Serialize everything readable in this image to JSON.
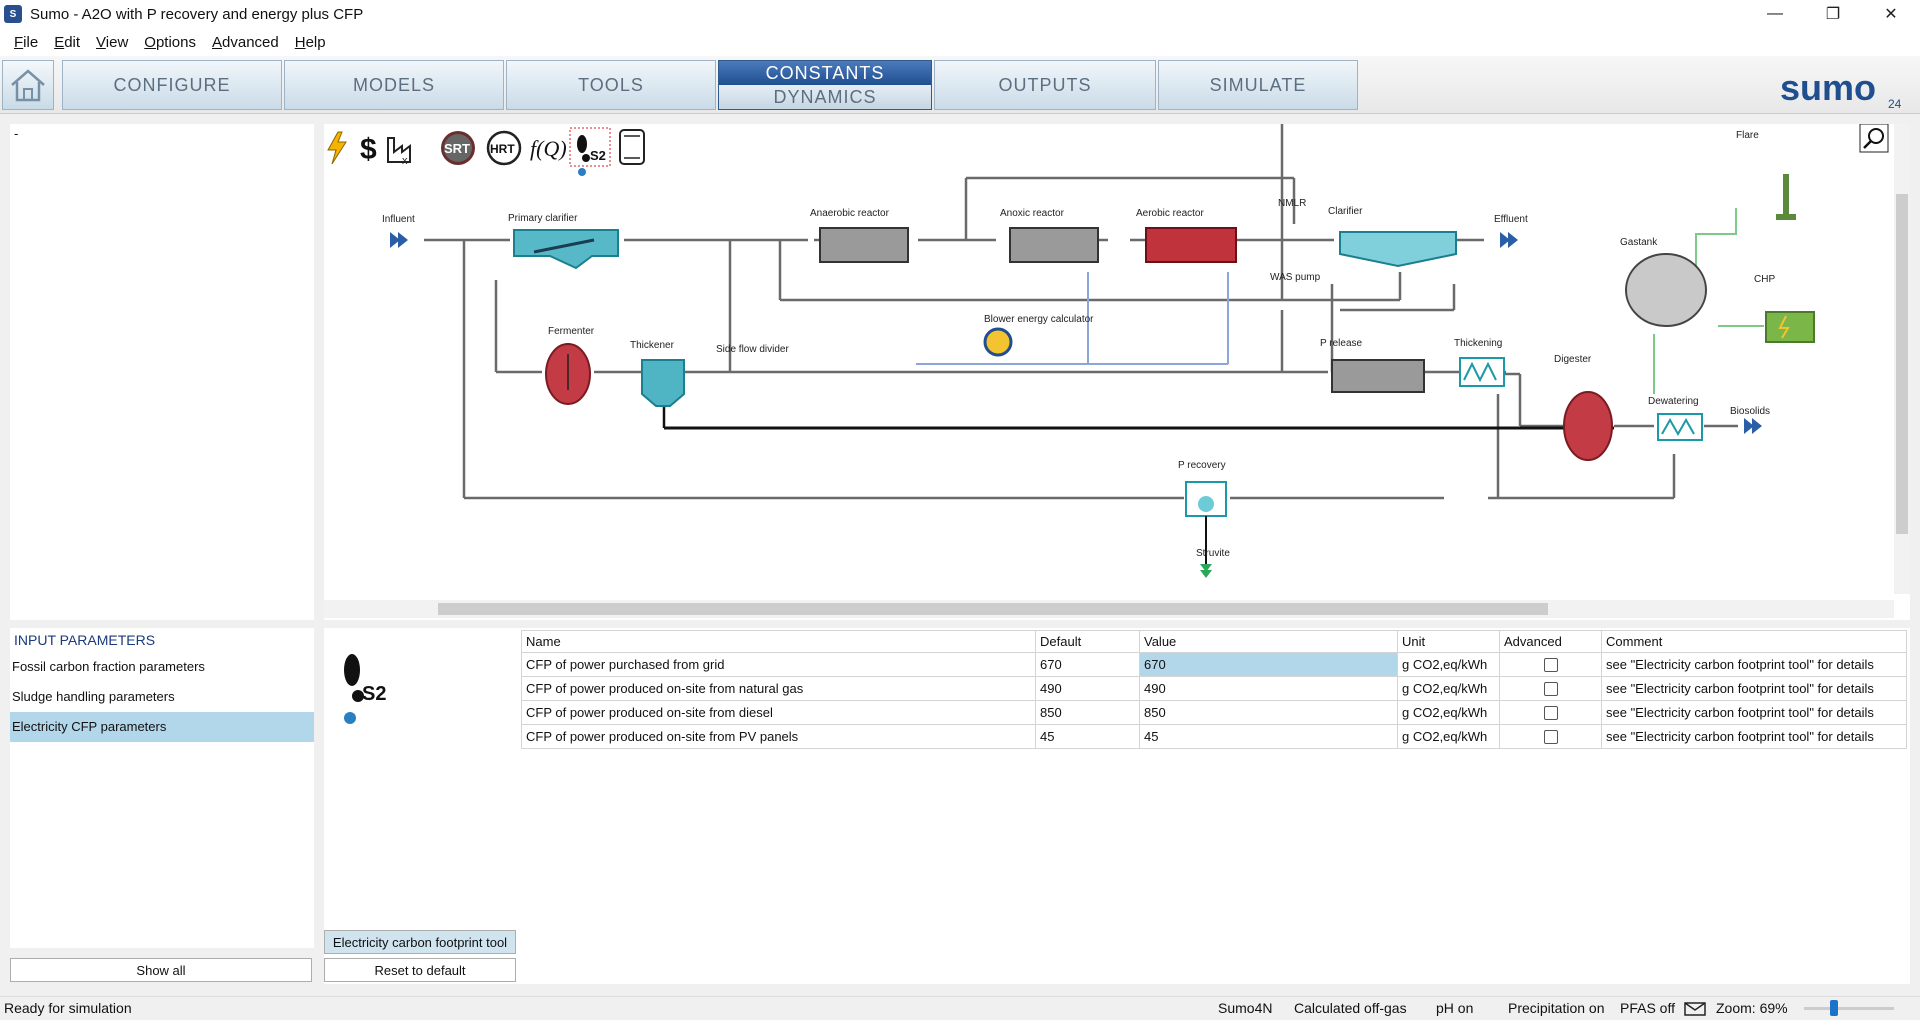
{
  "window": {
    "title": "Sumo - A2O with P recovery and energy plus CFP",
    "minimize": "—",
    "maximize": "❐",
    "close": "✕"
  },
  "menu": [
    {
      "label": "File",
      "key": "F"
    },
    {
      "label": "Edit",
      "key": "E"
    },
    {
      "label": "View",
      "key": "V"
    },
    {
      "label": "Options",
      "key": "O"
    },
    {
      "label": "Advanced",
      "key": "A"
    },
    {
      "label": "Help",
      "key": "H"
    }
  ],
  "tabs": {
    "configure": "CONFIGURE",
    "models": "MODELS",
    "tools": "TOOLS",
    "constants": "CONSTANTS",
    "dynamics": "DYNAMICS",
    "outputs": "OUTPUTS",
    "simulate": "SIMULATE"
  },
  "logo": {
    "text": "sumo",
    "sub": "24"
  },
  "left_top": {
    "text": "-"
  },
  "toolbar_icons": [
    "lightning-icon",
    "dollar-icon",
    "factory-icon",
    "srt-icon",
    "hrt-icon",
    "function-icon",
    "footprint-icon",
    "scroll-icon"
  ],
  "toolbar_labels": {
    "srt": "SRT",
    "hrt": "HRT",
    "fq": "f(Q)",
    "s2": "S2"
  },
  "diagram_labels": {
    "influent": "Influent",
    "primary_clarifier": "Primary clarifier",
    "fermenter": "Fermenter",
    "thickener": "Thickener",
    "side_flow_divider": "Side flow divider",
    "anaerobic_reactor": "Anaerobic reactor",
    "anoxic_reactor": "Anoxic reactor",
    "aerobic_reactor": "Aerobic reactor",
    "nmlr": "NMLR",
    "clarifier": "Clarifier",
    "effluent": "Effluent",
    "was_pump": "WAS pump",
    "blower": "Blower energy calculator",
    "p_release": "P release",
    "thickening": "Thickening",
    "digester": "Digester",
    "dewatering": "Dewatering",
    "biosolids": "Biosolids",
    "p_recovery": "P recovery",
    "struvite": "Struvite",
    "gastank": "Gastank",
    "chp": "CHP",
    "flare": "Flare"
  },
  "input_params": {
    "title": "INPUT PARAMETERS",
    "items": [
      "Fossil carbon fraction parameters",
      "Sludge handling parameters",
      "Electricity CFP parameters"
    ],
    "selected": 2
  },
  "buttons": {
    "show_all": "Show all",
    "reset": "Reset to default",
    "cfp_tool": "Electricity carbon footprint tool"
  },
  "table": {
    "headers": [
      "Name",
      "Default",
      "Value",
      "Unit",
      "Advanced",
      "Comment"
    ],
    "rows": [
      {
        "name": "CFP of power purchased from grid",
        "default": "670",
        "value": "670",
        "unit": "g CO2,eq/kWh",
        "advanced": false,
        "comment": "see \"Electricity carbon footprint tool\" for details"
      },
      {
        "name": "CFP of power produced on-site from natural gas",
        "default": "490",
        "value": "490",
        "unit": "g CO2,eq/kWh",
        "advanced": false,
        "comment": "see \"Electricity carbon footprint tool\" for details"
      },
      {
        "name": "CFP of power produced on-site from diesel",
        "default": "850",
        "value": "850",
        "unit": "g CO2,eq/kWh",
        "advanced": false,
        "comment": "see \"Electricity carbon footprint tool\" for details"
      },
      {
        "name": "CFP of power produced on-site from PV panels",
        "default": "45",
        "value": "45",
        "unit": "g CO2,eq/kWh",
        "advanced": false,
        "comment": "see \"Electricity carbon footprint tool\" for details"
      }
    ]
  },
  "status": {
    "left": "Ready for simulation",
    "model": "Sumo4N",
    "offgas": "Calculated off-gas",
    "ph": "pH on",
    "precip": "Precipitation on",
    "pfas": "PFAS off",
    "zoom": "Zoom: 69%",
    "zoom_level_percent": 69
  },
  "colors": {
    "accent_blue": "#1f4f8f",
    "teal": "#1aa3b5",
    "red_reactor": "#b22a33",
    "selection": "#b3d7ea"
  }
}
